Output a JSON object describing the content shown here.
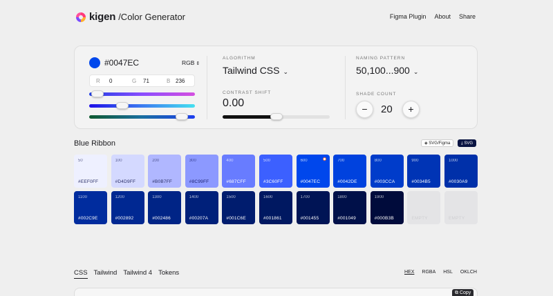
{
  "header": {
    "brand": "kigen",
    "subtitle": "/Color Generator",
    "nav": [
      "Figma Plugin",
      "About",
      "Share"
    ]
  },
  "color": {
    "hex": "#0047EC",
    "mode": "RGB",
    "r_label": "R",
    "r": "0",
    "g_label": "G",
    "g": "71",
    "b_label": "B",
    "b": "236"
  },
  "algorithm": {
    "label": "ALGORITHM",
    "value": "Tailwind CSS"
  },
  "contrast": {
    "label": "CONTRAST SHIFT",
    "value": "0.00",
    "level": 0.5
  },
  "naming": {
    "label": "NAMING PATTERN",
    "value": "50,100...900"
  },
  "shades": {
    "label": "SHADE COUNT",
    "value": "20",
    "minus": "−",
    "plus": "+"
  },
  "palette": {
    "name": "Blue Ribbon",
    "export_svg_figma": "SVG/Figma",
    "export_svg": "SVG",
    "active": "#0047EC",
    "tiles": [
      {
        "shade": "50",
        "hex": "#EEF0FF",
        "color": "#eef0ff",
        "text": "#2a2f66"
      },
      {
        "shade": "100",
        "hex": "#D4D9FF",
        "color": "#d4d9ff",
        "text": "#2a2f66"
      },
      {
        "shade": "200",
        "hex": "#B0B7FF",
        "color": "#b0b7ff",
        "text": "#2a2f66"
      },
      {
        "shade": "300",
        "hex": "#8C99FF",
        "color": "#8c99ff",
        "text": "#1d2370"
      },
      {
        "shade": "400",
        "hex": "#687CFF",
        "color": "#687cff",
        "text": "#ffffff"
      },
      {
        "shade": "500",
        "hex": "#3C60FF",
        "color": "#3c60ff",
        "text": "#ffffff"
      },
      {
        "shade": "600",
        "hex": "#0047EC",
        "color": "#0047ec",
        "text": "#ffffff"
      },
      {
        "shade": "700",
        "hex": "#0042DE",
        "color": "#0042de",
        "text": "#ffffff"
      },
      {
        "shade": "800",
        "hex": "#003CCA",
        "color": "#003cca",
        "text": "#ffffff"
      },
      {
        "shade": "900",
        "hex": "#0034B5",
        "color": "#0034b5",
        "text": "#ffffff"
      },
      {
        "shade": "1000",
        "hex": "#0030A9",
        "color": "#0030a9",
        "text": "#ffffff"
      },
      {
        "shade": "1100",
        "hex": "#002C9E",
        "color": "#002c9e",
        "text": "#ffffff"
      },
      {
        "shade": "1200",
        "hex": "#002892",
        "color": "#002892",
        "text": "#ffffff"
      },
      {
        "shade": "1300",
        "hex": "#002486",
        "color": "#002486",
        "text": "#ffffff"
      },
      {
        "shade": "1400",
        "hex": "#00207A",
        "color": "#00207a",
        "text": "#ffffff"
      },
      {
        "shade": "1500",
        "hex": "#001C6E",
        "color": "#001c6e",
        "text": "#ffffff"
      },
      {
        "shade": "1600",
        "hex": "#001861",
        "color": "#001861",
        "text": "#ffffff"
      },
      {
        "shade": "1700",
        "hex": "#001455",
        "color": "#001455",
        "text": "#ffffff"
      },
      {
        "shade": "1800",
        "hex": "#001049",
        "color": "#001049",
        "text": "#ffffff"
      },
      {
        "shade": "1900",
        "hex": "#000B3B",
        "color": "#000b3b",
        "text": "#ffffff"
      },
      {
        "shade": "",
        "hex": "EMPTY",
        "color": "",
        "text": ""
      },
      {
        "shade": "",
        "hex": "EMPTY",
        "color": "",
        "text": ""
      }
    ]
  },
  "code": {
    "tabs": [
      "CSS",
      "Tailwind",
      "Tailwind 4",
      "Tokens"
    ],
    "active_tab": "CSS",
    "formats": [
      "HEX",
      "RGBA",
      "HSL",
      "OKLCH"
    ],
    "active_format": "HEX",
    "copy": "Copy"
  }
}
